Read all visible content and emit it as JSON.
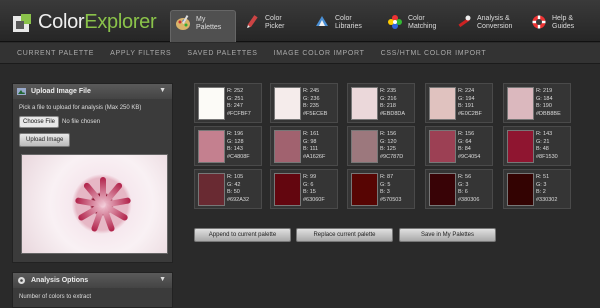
{
  "app": {
    "name_a": "Color",
    "name_b": "Explorer"
  },
  "tabs": [
    {
      "label": "My Palettes"
    },
    {
      "label": "Color Picker"
    },
    {
      "label": "Color Libraries"
    },
    {
      "label": "Color Matching"
    },
    {
      "label": "Analysis & Conversion"
    },
    {
      "label": "Help & Guides"
    }
  ],
  "subnav": [
    "CURRENT PALETTE",
    "APPLY FILTERS",
    "SAVED PALETTES",
    "IMAGE COLOR IMPORT",
    "CSS/HTML COLOR IMPORT"
  ],
  "upload": {
    "title": "Upload Image File",
    "instructions": "Pick a file to upload for analysis (Max 250 KB)",
    "choose_label": "Choose File",
    "no_file": "No file chosen",
    "upload_label": "Upload Image"
  },
  "analysis": {
    "title": "Analysis Options",
    "num_colors_label": "Number of colors to extract"
  },
  "swatches": [
    {
      "hex": "#FCFBF7",
      "r": "R: 252",
      "g": "G: 251",
      "b": "B: 247",
      "code": "#FCFBF7"
    },
    {
      "hex": "#F5ECEB",
      "r": "R: 245",
      "g": "G: 236",
      "b": "B: 235",
      "code": "#F5ECEB"
    },
    {
      "hex": "#EBD8DA",
      "r": "R: 235",
      "g": "G: 216",
      "b": "B: 218",
      "code": "#EBD8DA"
    },
    {
      "hex": "#E0C2BF",
      "r": "R: 224",
      "g": "G: 194",
      "b": "B: 191",
      "code": "#E0C2BF"
    },
    {
      "hex": "#DBB8BE",
      "r": "R: 219",
      "g": "G: 184",
      "b": "B: 190",
      "code": "#DBB8BE"
    },
    {
      "hex": "#C4808F",
      "r": "R: 196",
      "g": "G: 128",
      "b": "B: 143",
      "code": "#C4808F"
    },
    {
      "hex": "#A1626F",
      "r": "R: 161",
      "g": "G: 98",
      "b": "B: 111",
      "code": "#A1626F"
    },
    {
      "hex": "#9C787D",
      "r": "R: 156",
      "g": "G: 120",
      "b": "B: 125",
      "code": "#9C787D"
    },
    {
      "hex": "#9C4054",
      "r": "R: 156",
      "g": "G: 64",
      "b": "B: 84",
      "code": "#9C4054"
    },
    {
      "hex": "#8F1530",
      "r": "R: 143",
      "g": "G: 21",
      "b": "B: 48",
      "code": "#8F1530"
    },
    {
      "hex": "#692A32",
      "r": "R: 105",
      "g": "G: 42",
      "b": "B: 50",
      "code": "#692A32"
    },
    {
      "hex": "#63060F",
      "r": "R: 99",
      "g": "G: 6",
      "b": "B: 15",
      "code": "#63060F"
    },
    {
      "hex": "#570503",
      "r": "R: 87",
      "g": "G: 5",
      "b": "B: 3",
      "code": "#570503"
    },
    {
      "hex": "#380306",
      "r": "R: 56",
      "g": "G: 3",
      "b": "B: 6",
      "code": "#380306"
    },
    {
      "hex": "#330302",
      "r": "R: 51",
      "g": "G: 3",
      "b": "B: 2",
      "code": "#330302"
    }
  ],
  "actions": {
    "append": "Append to current palette",
    "replace": "Replace current palette",
    "save": "Save in My Palettes"
  },
  "colors": {
    "accent": "#8ac24a",
    "background": "#2a2a2a"
  }
}
